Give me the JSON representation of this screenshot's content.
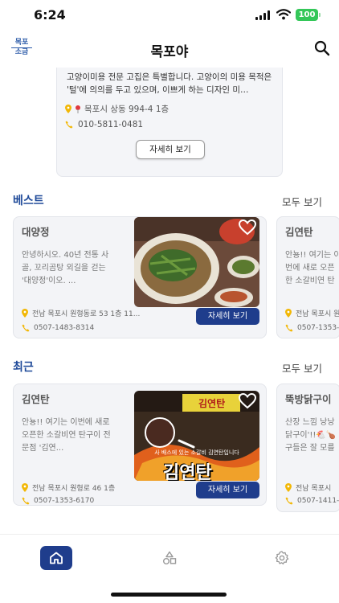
{
  "status_bar": {
    "time": "6:24",
    "battery": "100"
  },
  "header": {
    "title": "목포야",
    "logo_line1": "목포",
    "logo_line2": "소금"
  },
  "intro": {
    "description": "고양이미용 전문 고집은 특별합니다. 고양이의 미용 목적은 '털'에 의의를 두고 있으며, 이쁘게 하는 디자인 미…",
    "address": "목포시 상동 994-4 1층",
    "phone": "010-5811-0481",
    "more_label": "자세히 보기"
  },
  "best": {
    "title": "베스트",
    "see_all": "모두 보기",
    "cards": [
      {
        "name": "대양정",
        "description": "안녕하시오. 40년 전통 사골, 꼬리곰탕 외길을 걷는 '대양정'이오. ...",
        "address": "전남 목포시 원형동로 53 1층 11...",
        "phone": "0507-1483-8314",
        "button": "자세히 보기"
      },
      {
        "name": "김연탄",
        "description": "안뇽!! 여기는 이번에 새로 오픈한 소갈비연 탄구이 전문점",
        "address": "전남 목포시 원",
        "phone": "0507-1353-"
      }
    ]
  },
  "recent": {
    "title": "최근",
    "see_all": "모두 보기",
    "cards": [
      {
        "name": "김연탄",
        "description": "안뇽!! 여기는 이번에 새로 오픈한 소갈비연 탄구이 전문점 '김연...",
        "address": "전남 목포시 원형로 46 1층",
        "phone": "0507-1353-6170",
        "button": "자세히 보기",
        "sign_text": "김연탄",
        "caption": "사 배스에 있는 소갈비 김연탄입니다"
      },
      {
        "name": "뚝방닭구이",
        "description": "산장 느낌 낭낭 닭구이'!!🐔🍗 구들은 잘 모를",
        "address": "전남 목포시",
        "phone": "0507-1411-"
      }
    ]
  },
  "tab_bar": {
    "items": [
      "home",
      "shapes",
      "settings"
    ]
  },
  "colors": {
    "accent": "#1f3d8c",
    "section_title": "#1f4a99",
    "battery": "#34c759"
  }
}
